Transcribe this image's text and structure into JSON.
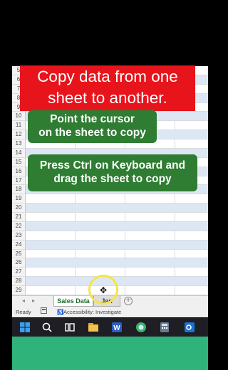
{
  "overlay": {
    "title_line1": "Copy data from one",
    "title_line2": "sheet to another.",
    "step1_line1": "Point the cursor",
    "step1_line2": "on the sheet to copy",
    "step2_line1": "Press Ctrl on Keyboard and",
    "step2_line2": "drag the sheet to copy"
  },
  "grid": {
    "row_numbers": [
      "5",
      "6",
      "7",
      "8",
      "9",
      "10",
      "11",
      "12",
      "13",
      "14",
      "15",
      "16",
      "17",
      "18",
      "19",
      "20",
      "21",
      "22",
      "23",
      "24",
      "25",
      "26",
      "27",
      "28",
      "29"
    ]
  },
  "sheet_tabs": {
    "active": "Sales Data",
    "other": "Jan",
    "add": "+"
  },
  "status": {
    "ready": "Ready",
    "accessibility": "Accessibility: Investigate"
  },
  "colors": {
    "title_bg": "#e8141c",
    "step_bg": "#2e7d32",
    "band": "#dde7f4",
    "bottom_green": "#2fb37b"
  },
  "taskbar": {
    "icons": [
      "windows-icon",
      "search-icon",
      "task-view-icon",
      "file-explorer-icon",
      "word-icon",
      "browser-icon",
      "calculator-icon",
      "outlook-icon"
    ]
  }
}
